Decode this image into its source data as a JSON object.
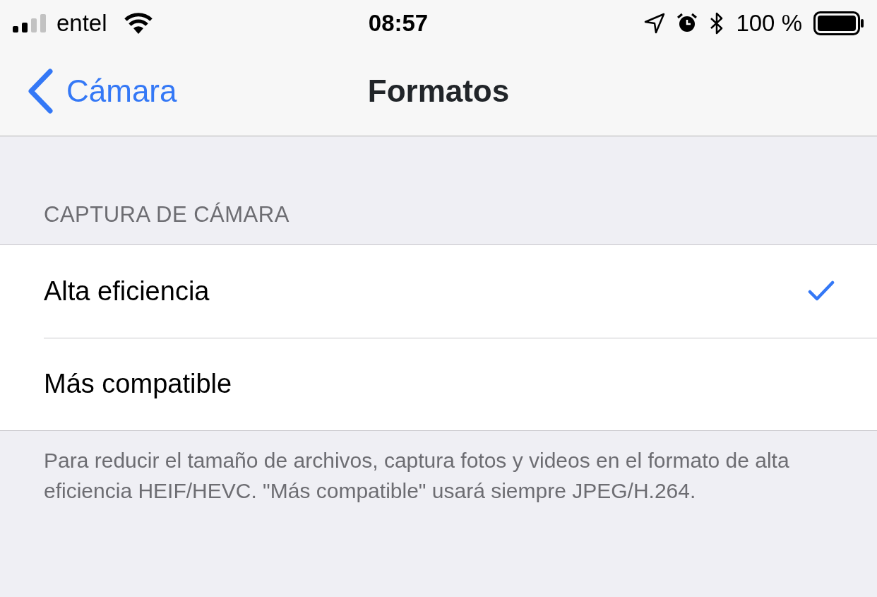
{
  "status_bar": {
    "carrier": "entel",
    "time": "08:57",
    "battery_text": "100 %"
  },
  "nav_bar": {
    "back_label": "Cámara",
    "title": "Formatos"
  },
  "section": {
    "header": "CAPTURA DE CÁMARA",
    "options": [
      {
        "label": "Alta eficiencia",
        "selected": true
      },
      {
        "label": "Más compatible",
        "selected": false
      }
    ],
    "footer": "Para reducir el tamaño de archivos, captura fotos y videos en el formato de alta eficiencia HEIF/HEVC. \"Más compatible\" usará siempre JPEG/H.264."
  }
}
